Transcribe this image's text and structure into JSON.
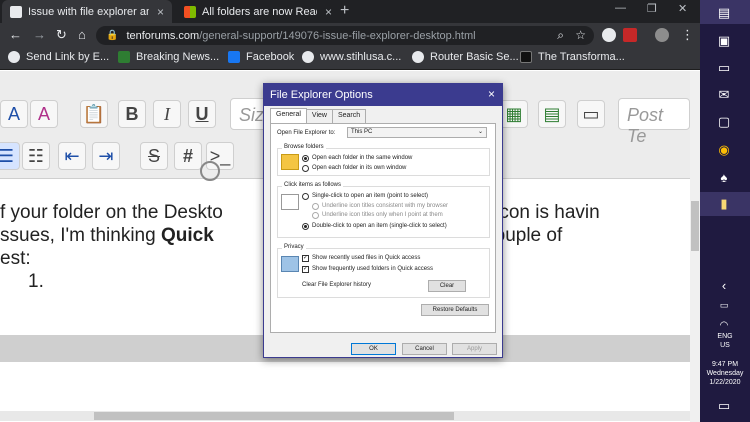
{
  "browser": {
    "tabs": [
      {
        "title": "Issue with file explorer anc",
        "active": true
      },
      {
        "title": "All folders are now Read C",
        "active": false
      }
    ],
    "new_tab": "+",
    "url_host": "tenforums.com",
    "url_path": "/general-support/149076-issue-file-explorer-desktop.html",
    "bookmarks": [
      {
        "label": "Send Link by E..."
      },
      {
        "label": "Breaking News..."
      },
      {
        "label": "Facebook"
      },
      {
        "label": "www.stihlusa.c..."
      },
      {
        "label": "Router Basic Se..."
      },
      {
        "label": "The Transforma..."
      }
    ]
  },
  "editor": {
    "size_placeholder": "Size",
    "post_placeholder": "Post Te"
  },
  "content": {
    "line1a": "f your folder on the Deskto",
    "line1b": "skbar icon is havin",
    "line2a": "ssues, I'm thinking ",
    "line2b": "Quick",
    "line2c": "e. So, a couple of",
    "line3": "est:",
    "list_item": "1."
  },
  "dialog": {
    "title": "File Explorer Options",
    "close": "×",
    "tabs": [
      "General",
      "View",
      "Search"
    ],
    "open_label": "Open File Explorer to:",
    "open_value": "This PC",
    "browse_group": "Browse folders",
    "browse_same": "Open each folder in the same window",
    "browse_own": "Open each folder in its own window",
    "click_group": "Click items as follows",
    "single_click": "Single-click to open an item (point to select)",
    "underline_consistent": "Underline icon titles consistent with my browser",
    "underline_point": "Underline icon titles only when I point at them",
    "double_click": "Double-click to open an item (single-click to select)",
    "privacy_group": "Privacy",
    "show_recent": "Show recently used files in Quick access",
    "show_frequent": "Show frequently used folders in Quick access",
    "clear_history": "Clear File Explorer history",
    "clear_btn": "Clear",
    "restore_btn": "Restore Defaults",
    "ok_btn": "OK",
    "cancel_btn": "Cancel",
    "apply_btn": "Apply"
  },
  "tray": {
    "lang1": "ENG",
    "lang2": "US",
    "time": "9:47 PM",
    "day": "Wednesday",
    "date": "1/22/2020"
  }
}
